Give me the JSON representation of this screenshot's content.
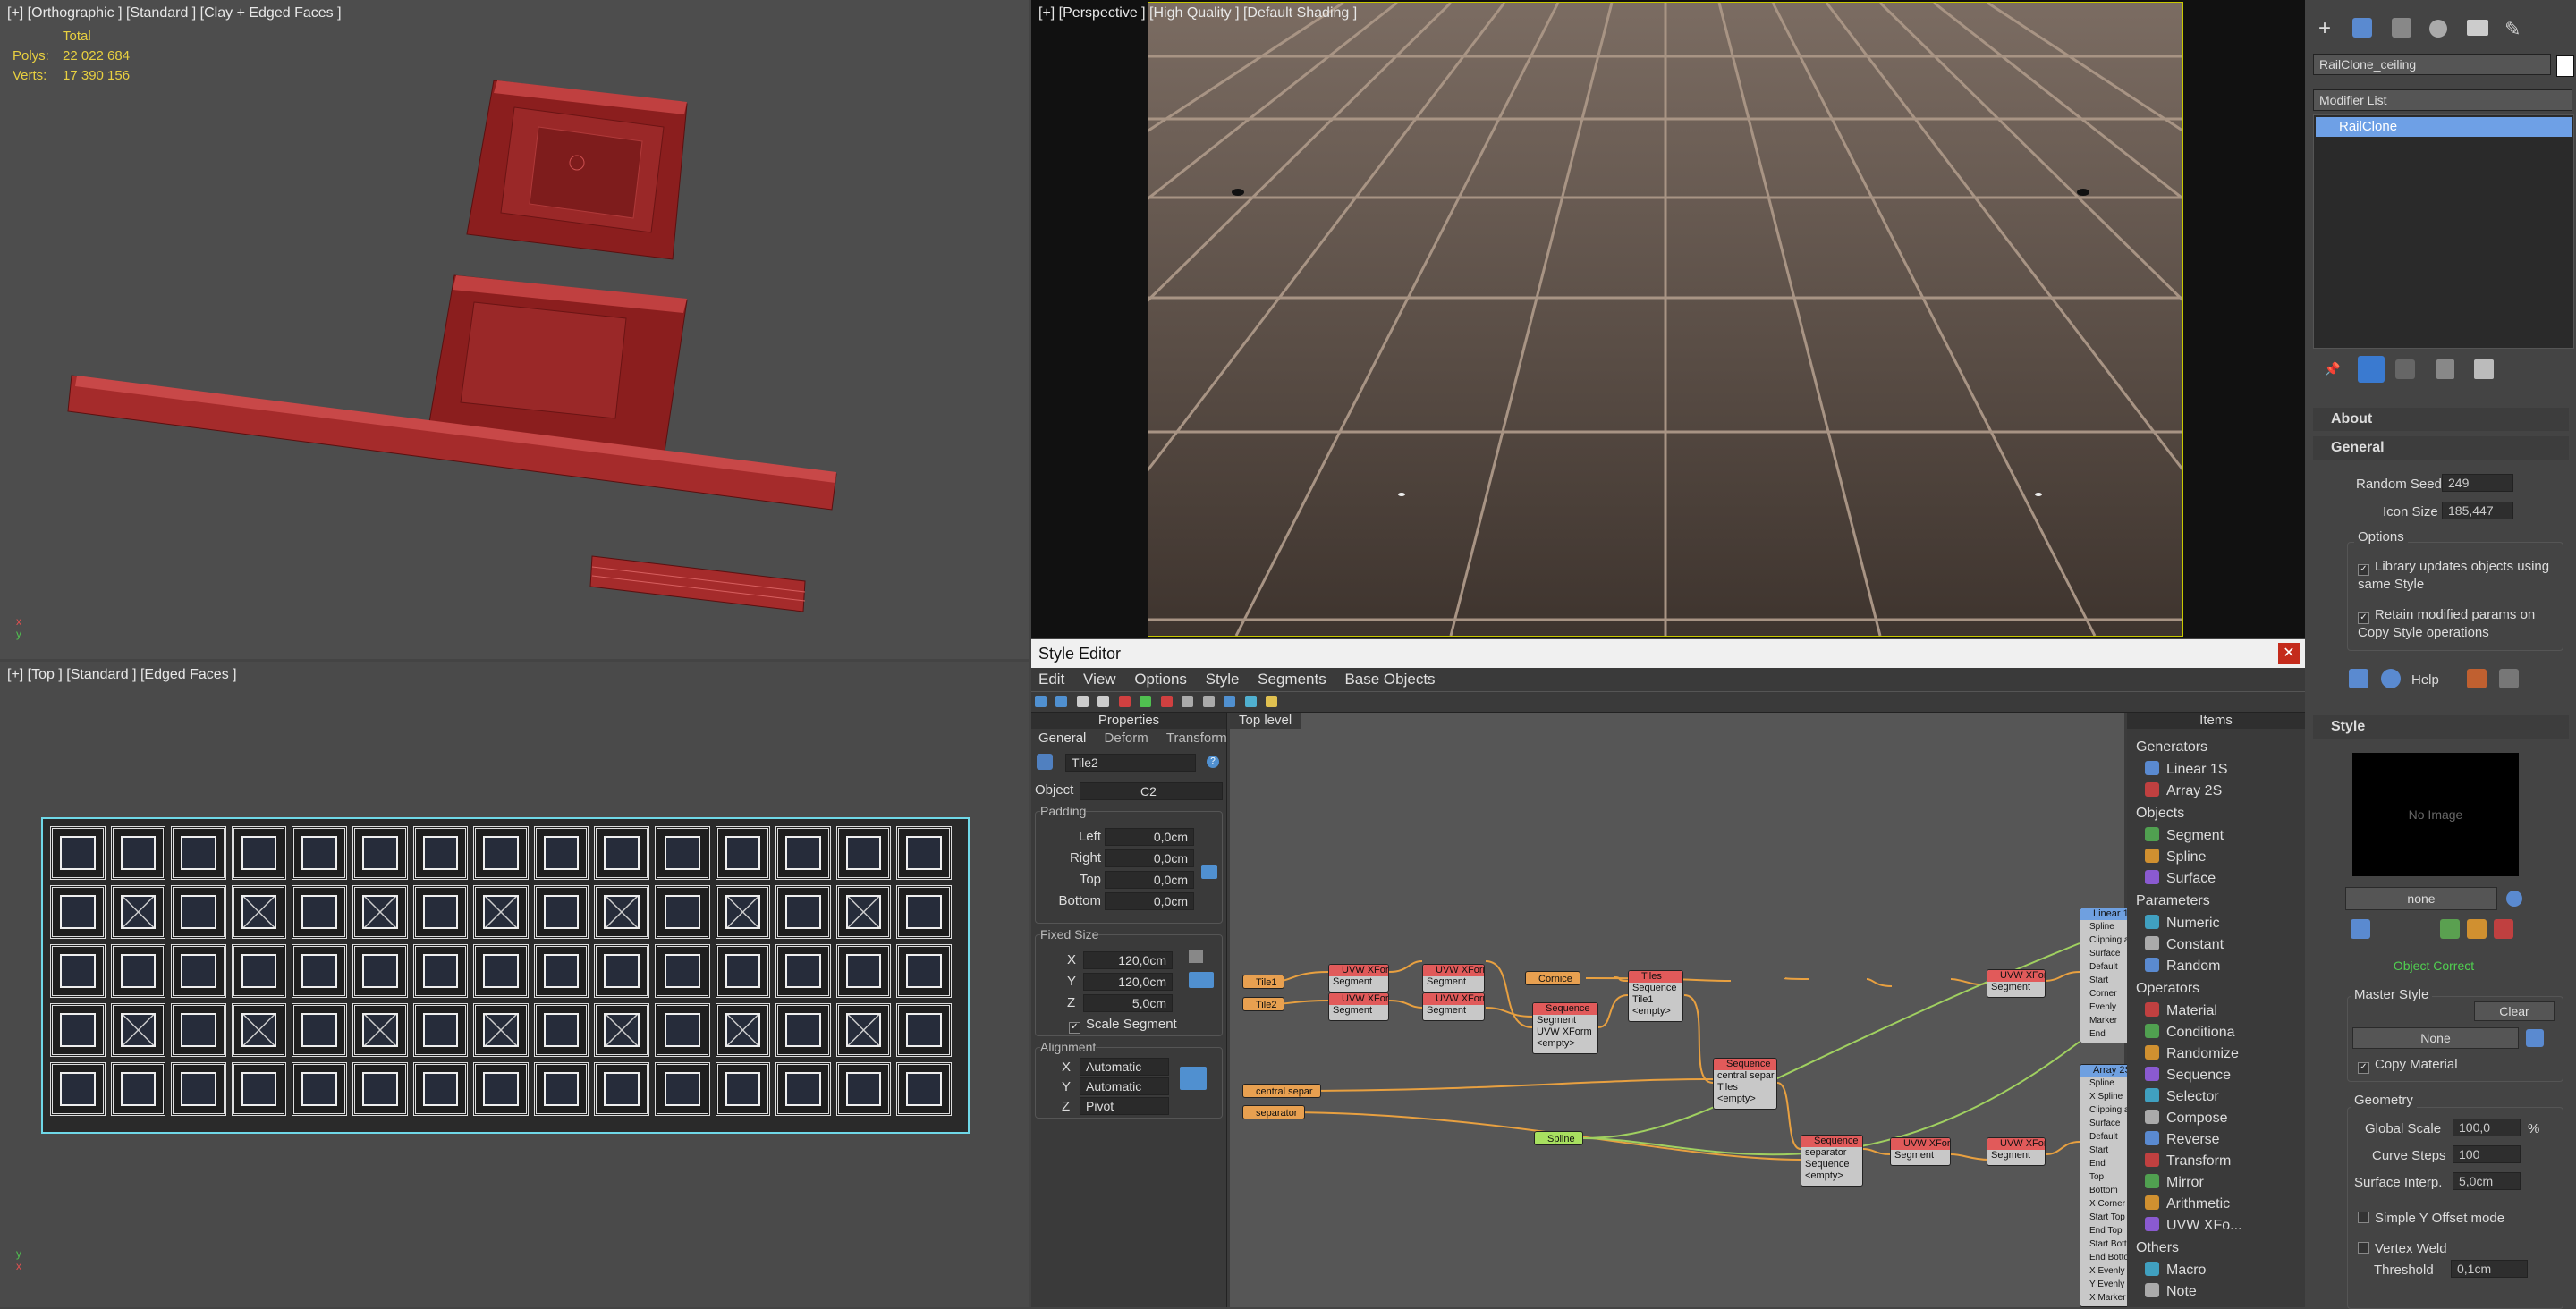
{
  "viewports": {
    "top_left": {
      "label": "[+] [Orthographic ] [Standard ] [Clay + Edged Faces ]",
      "stats_header": "Total",
      "polys_label": "Polys:",
      "polys_value": "22 022 684",
      "verts_label": "Verts:",
      "verts_value": "17 390 156"
    },
    "bottom_left": {
      "label": "[+] [Top ] [Standard ] [Edged Faces ]"
    },
    "perspective": {
      "label": "[+] [Perspective ] [High Quality ] [Default Shading ]"
    }
  },
  "style_editor": {
    "title": "Style Editor",
    "menu": [
      "Edit",
      "View",
      "Options",
      "Style",
      "Segments",
      "Base Objects"
    ],
    "properties": {
      "header": "Properties",
      "tabs": [
        "General",
        "Deform",
        "Transform"
      ],
      "name": "Tile2",
      "object_label": "Object",
      "object_value": "C2",
      "padding_label": "Padding",
      "padding": [
        {
          "label": "Left",
          "value": "0,0cm"
        },
        {
          "label": "Right",
          "value": "0,0cm"
        },
        {
          "label": "Top",
          "value": "0,0cm"
        },
        {
          "label": "Bottom",
          "value": "0,0cm"
        }
      ],
      "fixed_size_label": "Fixed Size",
      "fixed_size": [
        {
          "label": "X",
          "value": "120,0cm"
        },
        {
          "label": "Y",
          "value": "120,0cm"
        },
        {
          "label": "Z",
          "value": "5,0cm"
        }
      ],
      "scale_segment": "Scale Segment",
      "alignment_label": "Alignment",
      "alignment": [
        {
          "label": "X",
          "value": "Automatic"
        },
        {
          "label": "Y",
          "value": "Automatic"
        },
        {
          "label": "Z",
          "value": "Pivot"
        }
      ]
    },
    "canvas": {
      "tab": "Top level",
      "nodes": {
        "tile1": "Tile1",
        "tile2": "Tile2",
        "central": "central separ",
        "separator": "separator",
        "cornice": "Cornice",
        "spline": "Spline",
        "uvw": "UVW XForm",
        "segment": "Segment",
        "sequence": "Sequence",
        "tiles": "Tiles",
        "tile1_in": "Tile1",
        "empty": "<empty>",
        "central_in": "central separ",
        "tiles_in": "Tiles",
        "separator_in": "separator",
        "sequence_in": "Sequence",
        "linear": "Linear 1S",
        "array": "Array 2S"
      },
      "linear_ports": [
        "Spline",
        "Clipping ar",
        "Surface",
        "Default",
        "Start",
        "Corner",
        "Evenly",
        "Marker",
        "End"
      ],
      "array_ports": [
        "Spline",
        "X Spline",
        "Clipping ar",
        "Surface",
        "Default",
        "Start",
        "End",
        "Top",
        "Bottom",
        "X Corner",
        "Start Top",
        "End Top",
        "Start Botto",
        "End Botto",
        "X Evenly",
        "Y Evenly",
        "X Marker"
      ]
    },
    "items": {
      "header": "Items",
      "groups": [
        {
          "name": "Generators",
          "items": [
            "Linear 1S",
            "Array 2S"
          ]
        },
        {
          "name": "Objects",
          "items": [
            "Segment",
            "Spline",
            "Surface"
          ]
        },
        {
          "name": "Parameters",
          "items": [
            "Numeric",
            "Constant",
            "Random"
          ]
        },
        {
          "name": "Operators",
          "items": [
            "Material",
            "Conditiona",
            "Randomize",
            "Sequence",
            "Selector",
            "Compose",
            "Reverse",
            "Transform",
            "Mirror",
            "Arithmetic",
            "UVW XFo..."
          ]
        },
        {
          "name": "Others",
          "items": [
            "Macro",
            "Note"
          ]
        }
      ]
    }
  },
  "command_panel": {
    "object_name": "RailClone_ceiling",
    "modifier_list": "Modifier List",
    "stack_item": "RailClone",
    "about": "About",
    "general": "General",
    "random_seed_label": "Random Seed",
    "random_seed": "249",
    "icon_size_label": "Icon Size",
    "icon_size": "185,447",
    "options_label": "Options",
    "opt1": "Library updates objects using same Style",
    "opt2": "Retain modified params on Copy Style operations",
    "help": "Help",
    "style": "Style",
    "no_image": "No Image",
    "none": "none",
    "object_correct": "Object Correct",
    "master_style": "Master Style",
    "clear": "Clear",
    "none_btn": "None",
    "copy_material": "Copy Material",
    "geometry": "Geometry",
    "global_scale_label": "Global Scale",
    "global_scale": "100,0",
    "percent": "%",
    "curve_steps_label": "Curve Steps",
    "curve_steps": "100",
    "surface_interp_label": "Surface Interp.",
    "surface_interp": "5,0cm",
    "simple_y": "Simple Y Offset mode",
    "vertex_weld": "Vertex Weld",
    "threshold_label": "Threshold",
    "threshold": "0,1cm"
  }
}
